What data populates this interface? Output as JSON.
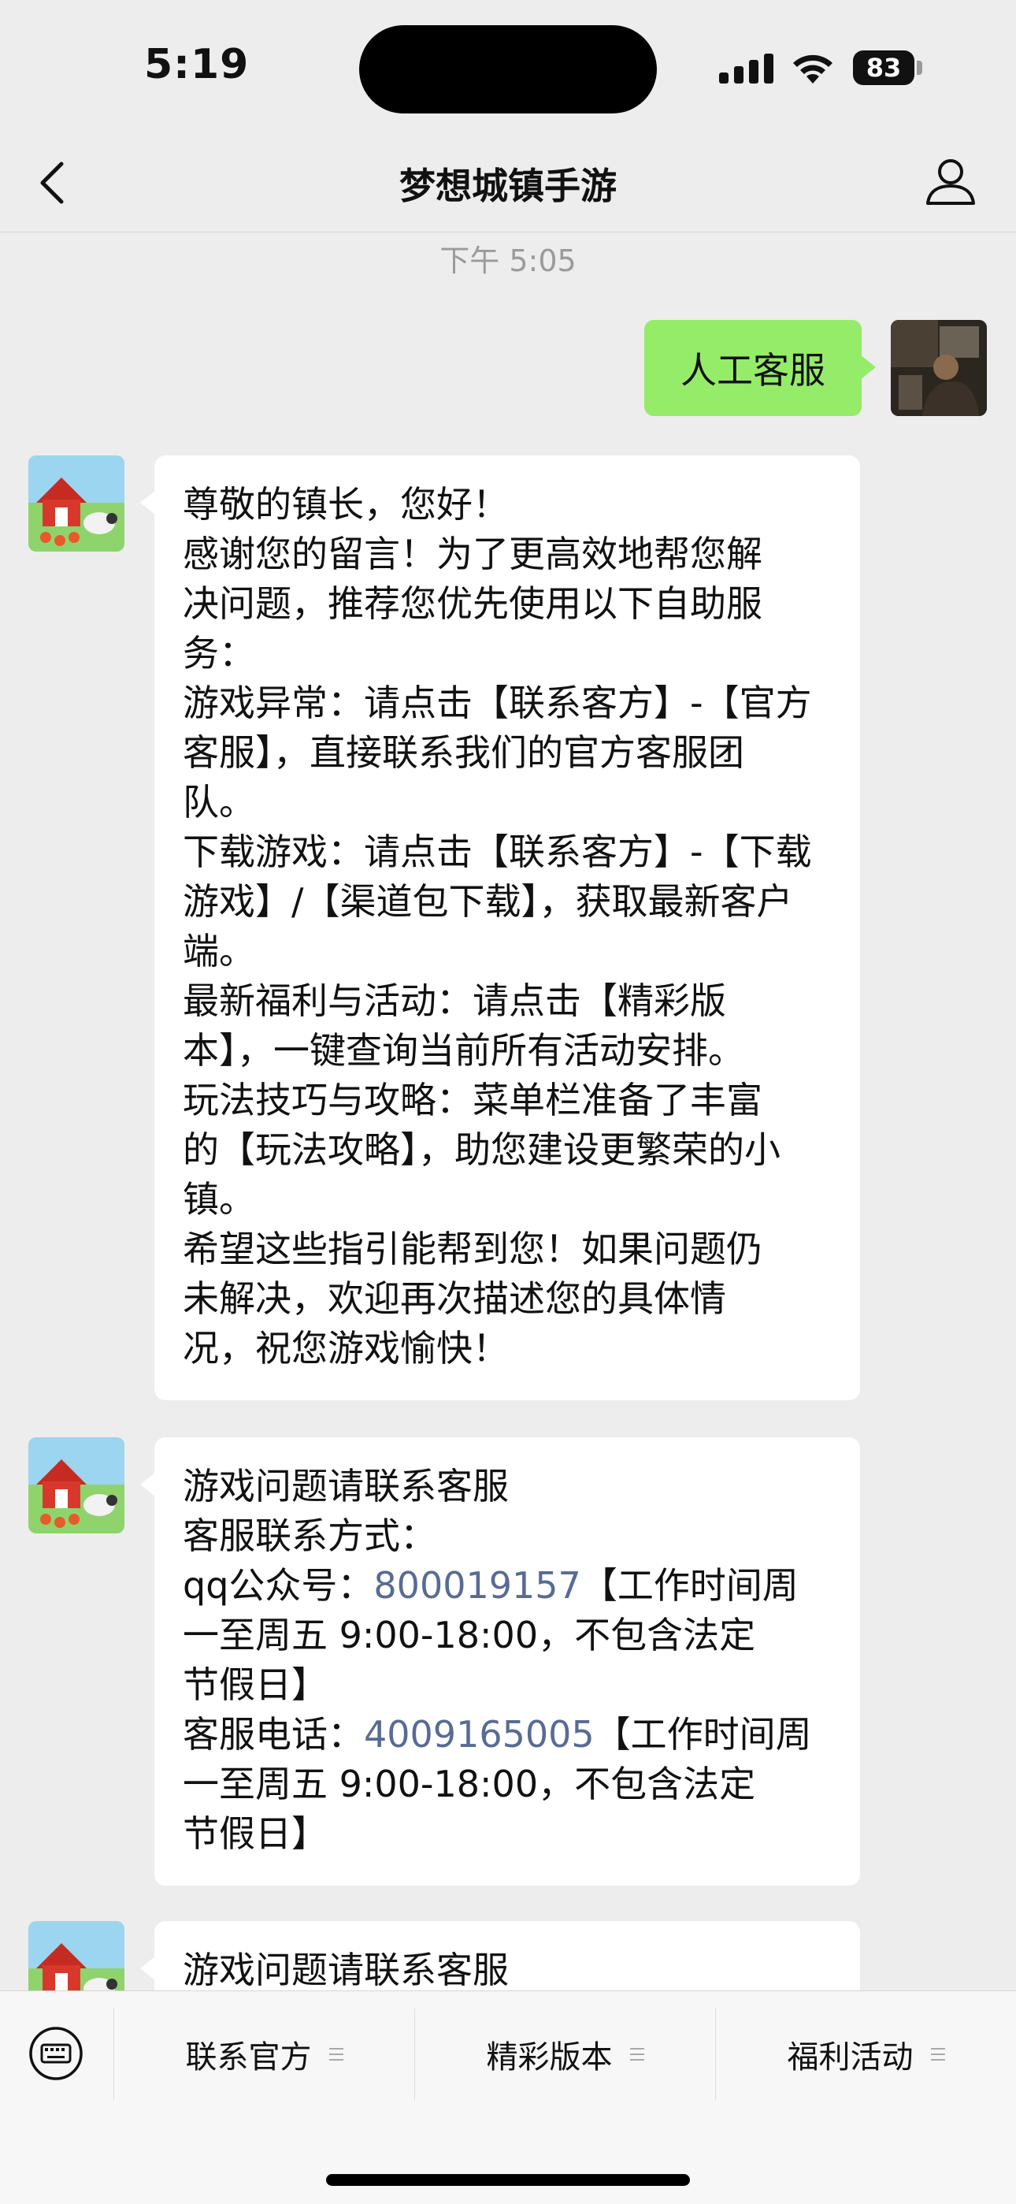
{
  "status_bar": {
    "time": "5:19",
    "battery": "83"
  },
  "nav": {
    "title": "梦想城镇手游"
  },
  "chat": {
    "timestamp": "下午 5:05",
    "user_message": "人工客服",
    "bot_message_1": [
      "尊敬的镇长，您好！",
      "感谢您的留言！为了更高效地帮您解",
      "决问题，推荐您优先使用以下自助服",
      "务：",
      "游戏异常：请点击【联系客方】-【官方",
      "客服】，直接联系我们的官方客服团",
      "队。",
      "下载游戏：请点击【联系客方】-【下载",
      "游戏】/【渠道包下载】，获取最新客户",
      "端。",
      "最新福利与活动：请点击【精彩版",
      "本】，一键查询当前所有活动安排。",
      "玩法技巧与攻略：菜单栏准备了丰富",
      "的【玩法攻略】，助您建设更繁荣的小",
      "镇。",
      "希望这些指引能帮到您！如果问题仍",
      "未解决，欢迎再次描述您的具体情",
      "况，祝您游戏愉快！"
    ],
    "bot_message_2": {
      "line1": "游戏问题请联系客服",
      "line2": "客服联系方式：",
      "qq_label": "qq公众号：",
      "qq_number": "800019157",
      "qq_hours_a": "【工作时间周",
      "hours_b": "一至周五 9:00-18:00，不包含法定",
      "hours_c": "节假日】",
      "phone_label": "客服电话：",
      "phone_number": "4009165005",
      "phone_hours_a": "【工作时间周"
    },
    "bot_message_3_preview": "游戏问题请联系客服"
  },
  "menu": {
    "items": [
      "联系官方",
      "精彩版本",
      "福利活动"
    ]
  },
  "icons": [
    "back-chevron-icon",
    "profile-icon",
    "keyboard-icon",
    "menu-list-icon"
  ],
  "colors": {
    "user_bubble": "#95ec69",
    "link": "#576b95",
    "background": "#ededed"
  }
}
